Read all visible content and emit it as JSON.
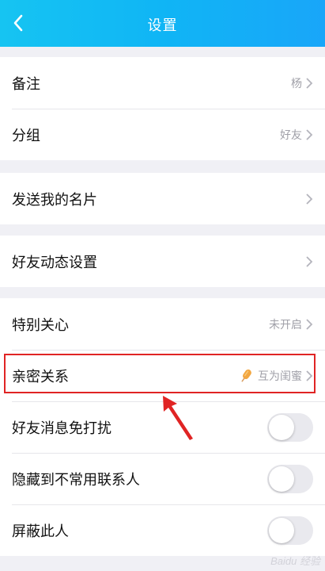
{
  "header": {
    "title": "设置",
    "back_icon": "chevron-left-icon"
  },
  "groups": [
    {
      "rows": [
        {
          "label": "备注",
          "value": "杨"
        },
        {
          "label": "分组",
          "value": "好友"
        }
      ]
    },
    {
      "rows": [
        {
          "label": "发送我的名片",
          "value": ""
        }
      ]
    },
    {
      "rows": [
        {
          "label": "好友动态设置",
          "value": ""
        }
      ]
    },
    {
      "rows": [
        {
          "label": "特别关心",
          "value": "未开启"
        },
        {
          "label": "亲密关系",
          "value": "互为闺蜜",
          "icon": "popsicle-icon"
        },
        {
          "label": "好友消息免打扰",
          "toggle": false
        },
        {
          "label": "隐藏到不常用联系人",
          "toggle": false
        },
        {
          "label": "屏蔽此人",
          "toggle": false
        }
      ]
    }
  ],
  "annotation": {
    "highlight_color": "#e02424"
  },
  "watermark": "Baidu 经验",
  "colors": {
    "header_gradient_start": "#16c4f2",
    "header_gradient_end": "#19a6f9",
    "page_background": "#f0f0f5"
  }
}
